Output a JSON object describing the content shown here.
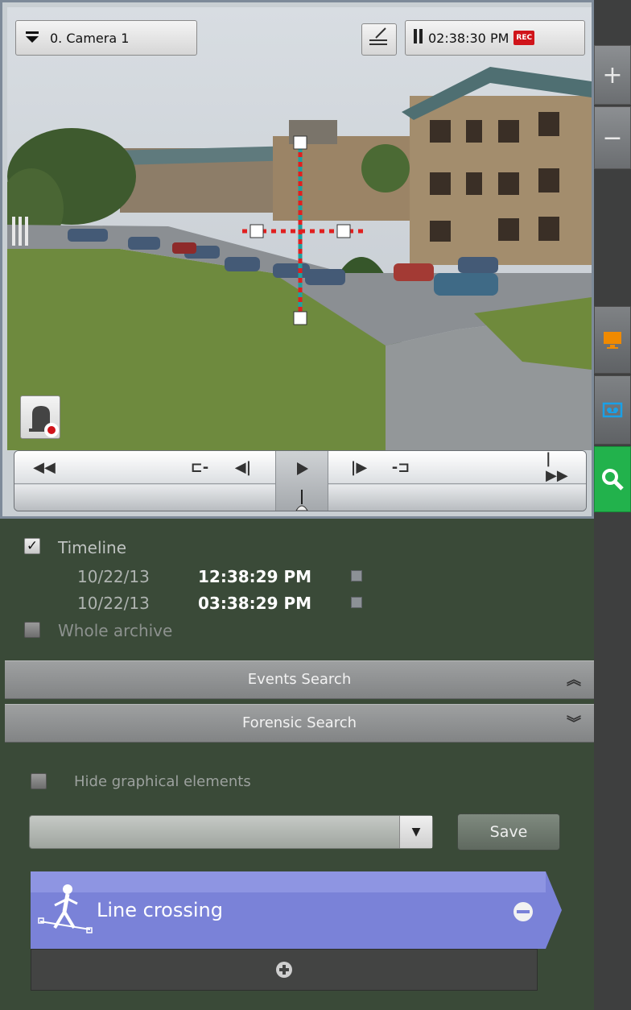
{
  "camera": {
    "selector_label": "0. Camera 1",
    "time": "02:38:30 PM",
    "rec_badge": "REC"
  },
  "playback": {
    "buttons": [
      "rewind-start",
      "step-back-frame",
      "prev-frame",
      "play",
      "next-frame",
      "step-forward-frame",
      "forward-end"
    ]
  },
  "search_range": {
    "timeline_label": "Timeline",
    "timeline_checked": true,
    "start_date": "10/22/13",
    "start_time": "12:38:29 PM",
    "end_date": "10/22/13",
    "end_time": "03:38:29 PM",
    "whole_archive_label": "Whole archive",
    "whole_archive_checked": false
  },
  "sections": {
    "events_search": "Events Search",
    "forensic_search": "Forensic Search"
  },
  "forensic": {
    "hide_graphical_label": "Hide graphical elements",
    "combo_value": "",
    "save_label": "Save",
    "rule_label": "Line crossing"
  },
  "colors": {
    "panel_green": "#3a4a38",
    "rule_blue": "#7a82d8",
    "search_active": "#22b24c",
    "monitor_orange": "#f08a00",
    "archive_blue": "#1aa0e6"
  }
}
